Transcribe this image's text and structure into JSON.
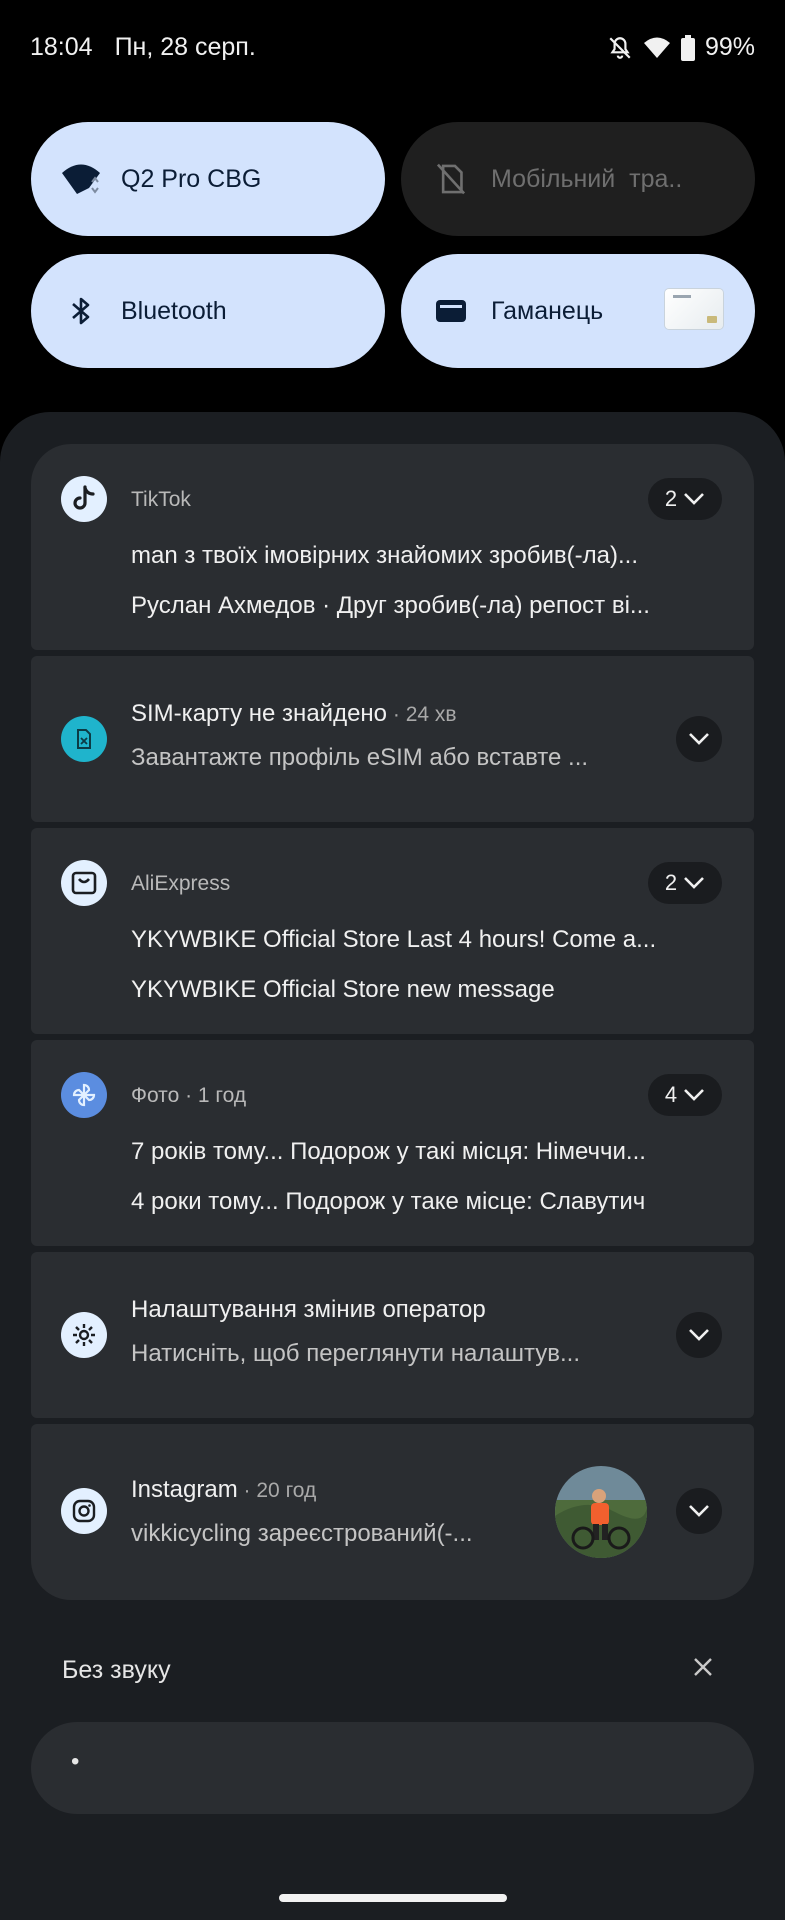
{
  "status_bar": {
    "time": "18:04",
    "date": "Пн, 28 серп.",
    "battery": "99%"
  },
  "quick_tiles": [
    {
      "label": "Q2 Pro CBG",
      "icon": "wifi-icon",
      "state": "on"
    },
    {
      "label": "Мобільний  тра..",
      "icon": "no-sim-icon",
      "state": "off"
    },
    {
      "label": "Bluetooth",
      "icon": "bluetooth-icon",
      "state": "on"
    },
    {
      "label": "Гаманець",
      "icon": "wallet-icon",
      "state": "on"
    }
  ],
  "notifications": [
    {
      "app": "TikTok",
      "count": "2",
      "line1": "man з твоїх імовірних знайомих зробив(-ла)...",
      "line2": "Руслан Ахмедов · Друг зробив(-ла) репост ві..."
    },
    {
      "title": "SIM-карту не знайдено",
      "meta": " · 24 хв",
      "line2": "Завантажте профіль eSIM або вставте ..."
    },
    {
      "app": "AliExpress",
      "count": "2",
      "line1": "YKYWBIKE Official Store Last 4 hours! Come a...",
      "line2": "YKYWBIKE Official Store new message"
    },
    {
      "app": "Фото",
      "meta": " · 1 год",
      "count": "4",
      "line1": "7 років тому... Подорож у такі місця: Німеччи...",
      "line2": "4 роки тому... Подорож у таке місце: Славутич"
    },
    {
      "title": "Налаштування змінив оператор",
      "line2": "Натисніть, щоб переглянути налаштув..."
    },
    {
      "title": "Instagram",
      "meta": " · 20 год",
      "line2": "vikkicycling зареєстрований(-..."
    }
  ],
  "silent_section": {
    "label": "Без звуку",
    "dot": "•"
  },
  "colors": {
    "tile_active": "#d3e3fd",
    "card": "#2a2d31",
    "sheet": "#1b1e22",
    "sim_icon": "#1fb4cc",
    "photos_icon": "#5b8de0"
  }
}
